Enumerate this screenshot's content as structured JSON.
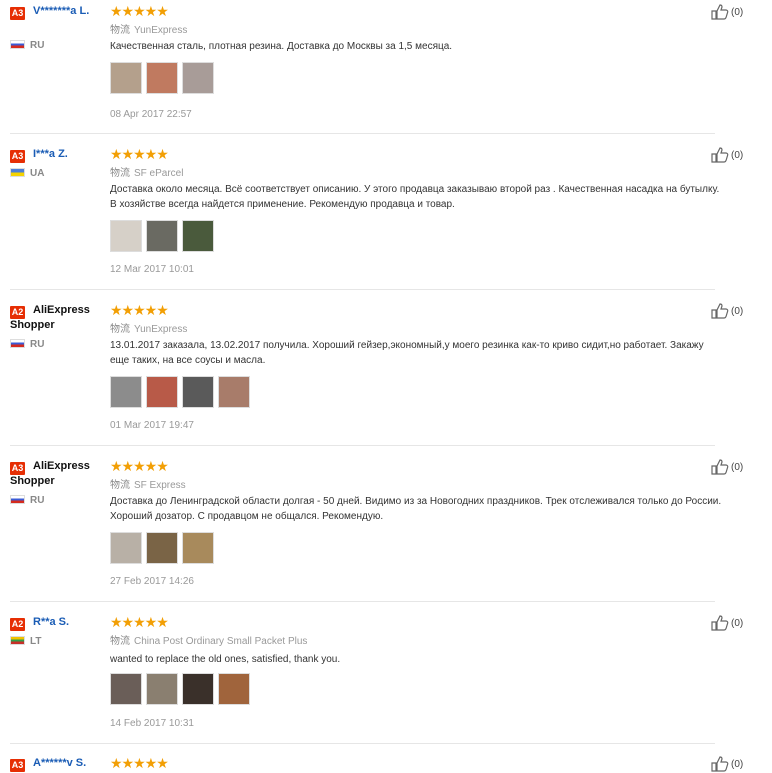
{
  "shipping_label": "物流",
  "reviews": [
    {
      "badge": "A3",
      "name": "V*******a L.",
      "country": "RU",
      "flag": "ru",
      "stars": "★★★★★",
      "shipping": "YunExpress",
      "text": "Качественная сталь, плотная резина. Доставка до Москвы за 1,5 месяца.",
      "photos": [
        "#b4a08c",
        "#c07a60",
        "#a89c98"
      ],
      "date": "08 Apr 2017 22:57",
      "likes": "(0)"
    },
    {
      "badge": "A3",
      "name": "I***a Z.",
      "country": "UA",
      "flag": "ua",
      "stars": "★★★★★",
      "shipping": "SF eParcel",
      "text": "Доставка около месяца. Всё соответствует описанию. У этого продавца заказываю второй раз . Качественная насадка на бутылку. В хозяйстве всегда найдется применение. Рекомендую продавца и товар.",
      "photos": [
        "#d6d0c8",
        "#6a6a62",
        "#4a5a3c"
      ],
      "date": "12 Mar 2017 10:01",
      "likes": "(0)"
    },
    {
      "badge": "A2",
      "name": "AliExpress Shopper",
      "country": "RU",
      "flag": "ru",
      "stars": "★★★★★",
      "shipping": "YunExpress",
      "text": "13.01.2017 заказала, 13.02.2017 получила. Хороший гейзер,экономный,у моего резинка как-то криво сидит,но работает. Закажу еще таких, на все соусы и масла.",
      "photos": [
        "#8c8c8c",
        "#b85a48",
        "#5a5a5a",
        "#a87c6a"
      ],
      "date": "01 Mar 2017 19:47",
      "likes": "(0)"
    },
    {
      "badge": "A3",
      "name": "AliExpress Shopper",
      "country": "RU",
      "flag": "ru",
      "stars": "★★★★★",
      "shipping": "SF Express",
      "text": "Доставка до Ленинградской области долгая - 50 дней. Видимо из за Новогодних праздников. Трек отслеживался только до России. Хороший дозатор. С продавцом не общался. Рекомендую.",
      "photos": [
        "#b8b0a6",
        "#7a6446",
        "#a88a5c"
      ],
      "date": "27 Feb 2017 14:26",
      "likes": "(0)"
    },
    {
      "badge": "A2",
      "name": "R**a S.",
      "country": "LT",
      "flag": "lt",
      "stars": "★★★★★",
      "shipping": "China Post Ordinary Small Packet Plus",
      "text": "wanted to replace the old ones, satisfied, thank you.",
      "photos": [
        "#6a5e58",
        "#8a7f70",
        "#3a302a",
        "#a0643c"
      ],
      "date": "14 Feb 2017 10:31",
      "likes": "(0)"
    },
    {
      "badge": "A3",
      "name": "A******v S.",
      "stars": "★★★★★",
      "likes": "(0)"
    }
  ]
}
